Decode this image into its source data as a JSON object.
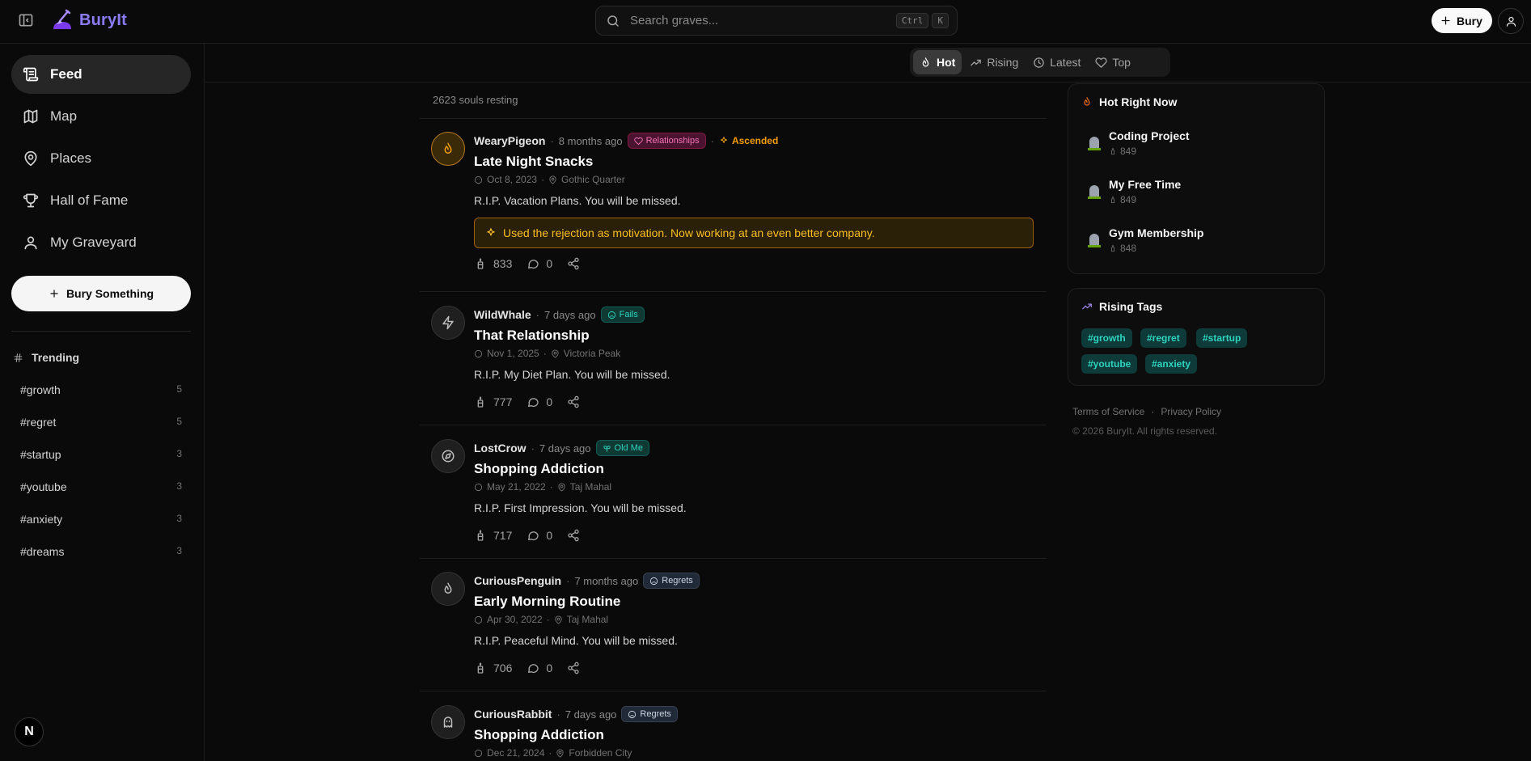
{
  "app": {
    "name": "BuryIt"
  },
  "search": {
    "placeholder": "Search graves...",
    "kbd1": "Ctrl",
    "kbd2": "K"
  },
  "header": {
    "bury_label": "Bury"
  },
  "sidebar": {
    "nav": [
      {
        "label": "Feed",
        "icon": "scroll-icon",
        "active": true
      },
      {
        "label": "Map",
        "icon": "map-icon"
      },
      {
        "label": "Places",
        "icon": "map-pin-icon"
      },
      {
        "label": "Hall of Fame",
        "icon": "trophy-icon"
      },
      {
        "label": "My Graveyard",
        "icon": "user-icon"
      }
    ],
    "bury_something": "Bury Something",
    "trending_label": "Trending",
    "trending": [
      {
        "tag": "#growth",
        "count": "5"
      },
      {
        "tag": "#regret",
        "count": "5"
      },
      {
        "tag": "#startup",
        "count": "3"
      },
      {
        "tag": "#youtube",
        "count": "3"
      },
      {
        "tag": "#anxiety",
        "count": "3"
      },
      {
        "tag": "#dreams",
        "count": "3"
      }
    ],
    "badge_letter": "N"
  },
  "sort_tabs": [
    {
      "label": "Hot",
      "active": true
    },
    {
      "label": "Rising"
    },
    {
      "label": "Latest"
    },
    {
      "label": "Top"
    }
  ],
  "feed": {
    "souls": "2623 souls resting",
    "posts": [
      {
        "user": "WearyPigeon",
        "time": "8 months ago",
        "badge": "Relationships",
        "extra": "Ascended",
        "title": "Late Night Snacks",
        "date": "Oct 8, 2023",
        "place": "Gothic Quarter",
        "text": "R.I.P. Vacation Plans. You will be missed.",
        "resurrection": "Used the rejection as motivation. Now working at an even better company.",
        "candles": "833",
        "comments": "0"
      },
      {
        "user": "WildWhale",
        "time": "7 days ago",
        "badge": "Fails",
        "title": "That Relationship",
        "date": "Nov 1, 2025",
        "place": "Victoria Peak",
        "text": "R.I.P. My Diet Plan. You will be missed.",
        "candles": "777",
        "comments": "0"
      },
      {
        "user": "LostCrow",
        "time": "7 days ago",
        "badge": "Old Me",
        "title": "Shopping Addiction",
        "date": "May 21, 2022",
        "place": "Taj Mahal",
        "text": "R.I.P. First Impression. You will be missed.",
        "candles": "717",
        "comments": "0"
      },
      {
        "user": "CuriousPenguin",
        "time": "7 months ago",
        "badge": "Regrets",
        "title": "Early Morning Routine",
        "date": "Apr 30, 2022",
        "place": "Taj Mahal",
        "text": "R.I.P. Peaceful Mind. You will be missed.",
        "candles": "706",
        "comments": "0"
      },
      {
        "user": "CuriousRabbit",
        "time": "7 days ago",
        "badge": "Regrets",
        "title": "Shopping Addiction",
        "date": "Dec 21, 2024",
        "place": "Forbidden City"
      }
    ]
  },
  "hot": {
    "title": "Hot Right Now",
    "items": [
      {
        "name": "Coding Project",
        "count": "849"
      },
      {
        "name": "My Free Time",
        "count": "849"
      },
      {
        "name": "Gym Membership",
        "count": "848"
      }
    ]
  },
  "rising_tags": {
    "title": "Rising Tags",
    "tags": [
      "#growth",
      "#regret",
      "#startup",
      "#youtube",
      "#anxiety"
    ]
  },
  "footer": {
    "terms": "Terms of Service",
    "sep": "·",
    "privacy": "Privacy Policy",
    "copyright": "© 2026 BuryIt. All rights reserved."
  },
  "colors": {
    "brand": "#8b5cf6",
    "gold": "#f59e0b",
    "teal": "#2dd4bf",
    "pink": "#f472b6",
    "bg": "#0a0a0a"
  }
}
